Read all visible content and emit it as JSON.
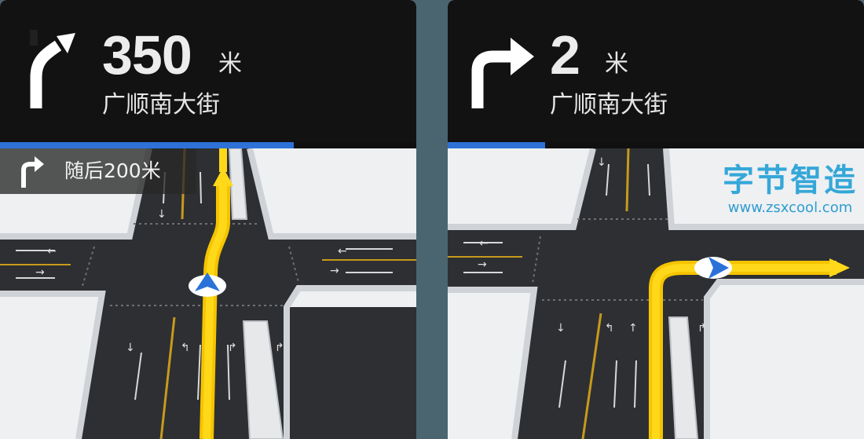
{
  "panels": [
    {
      "distance_value": "350",
      "distance_unit": "米",
      "street": "广顺南大街",
      "maneuver_icon": "turn-slight-right-arrow-icon",
      "route_progress": 0.705,
      "next_instruction": {
        "icon": "turn-right-arrow-icon",
        "text": "随后200米"
      },
      "map": {
        "vehicle_icon": "vehicle-position-icon",
        "route_color": "#ffcc00"
      }
    },
    {
      "distance_value": "2",
      "distance_unit": "米",
      "street": "广顺南大街",
      "maneuver_icon": "turn-right-arrow-icon",
      "route_progress": 0.22,
      "map": {
        "vehicle_icon": "vehicle-position-icon",
        "route_color": "#ffcc00"
      },
      "watermark": {
        "logo_text": "字节智造",
        "url": "www.zsxcool.com"
      }
    }
  ],
  "colors": {
    "header_bg": "#121212",
    "progress": "#2e72d9",
    "road": "#2e2f33",
    "block": "#eef0f2",
    "lane_yellow": "#c69a1b",
    "route": "#ffcc00"
  }
}
